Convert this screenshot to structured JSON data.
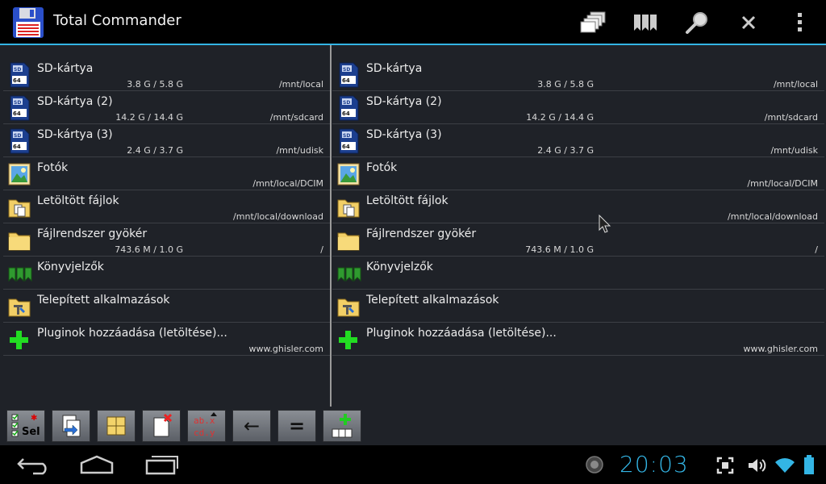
{
  "app": {
    "title": "Total Commander"
  },
  "actionbar": {
    "icons": [
      "windows-icon",
      "bookmarks-icon",
      "search-icon",
      "close-icon",
      "overflow-menu-icon"
    ]
  },
  "left_panel": {
    "rows": [
      {
        "name": "SD-kártya",
        "size": "3.8 G / 5.8 G",
        "path": "/mnt/local",
        "icon": "sd-card-icon"
      },
      {
        "name": "SD-kártya (2)",
        "size": "14.2 G / 14.4 G",
        "path": "/mnt/sdcard",
        "icon": "sd-card-icon"
      },
      {
        "name": "SD-kártya (3)",
        "size": "2.4 G / 3.7 G",
        "path": "/mnt/udisk",
        "icon": "sd-card-icon"
      },
      {
        "name": "Fotók",
        "size": "",
        "path": "/mnt/local/DCIM",
        "icon": "photos-icon"
      },
      {
        "name": "Letöltött fájlok",
        "size": "",
        "path": "/mnt/local/download",
        "icon": "downloads-folder-icon"
      },
      {
        "name": "Fájlrendszer gyökér",
        "size": "743.6 M / 1.0 G",
        "path": "/",
        "icon": "folder-icon"
      },
      {
        "name": "Könyvjelzők",
        "size": "",
        "path": "",
        "icon": "bookmarks-icon"
      },
      {
        "name": "Telepített alkalmazások",
        "size": "",
        "path": "",
        "icon": "apps-folder-icon"
      },
      {
        "name": "Pluginok hozzáadása (letöltése)...",
        "size": "",
        "path": "www.ghisler.com",
        "icon": "add-plugin-icon"
      }
    ]
  },
  "right_panel": {
    "rows": [
      {
        "name": "SD-kártya",
        "size": "3.8 G / 5.8 G",
        "path": "/mnt/local",
        "icon": "sd-card-icon"
      },
      {
        "name": "SD-kártya (2)",
        "size": "14.2 G / 14.4 G",
        "path": "/mnt/sdcard",
        "icon": "sd-card-icon"
      },
      {
        "name": "SD-kártya (3)",
        "size": "2.4 G / 3.7 G",
        "path": "/mnt/udisk",
        "icon": "sd-card-icon"
      },
      {
        "name": "Fotók",
        "size": "",
        "path": "/mnt/local/DCIM",
        "icon": "photos-icon"
      },
      {
        "name": "Letöltött fájlok",
        "size": "",
        "path": "/mnt/local/download",
        "icon": "downloads-folder-icon"
      },
      {
        "name": "Fájlrendszer gyökér",
        "size": "743.6 M / 1.0 G",
        "path": "/",
        "icon": "folder-icon"
      },
      {
        "name": "Könyvjelzők",
        "size": "",
        "path": "",
        "icon": "bookmarks-icon"
      },
      {
        "name": "Telepített alkalmazások",
        "size": "",
        "path": "",
        "icon": "apps-folder-icon"
      },
      {
        "name": "Pluginok hozzáadása (letöltése)...",
        "size": "",
        "path": "www.ghisler.com",
        "icon": "add-plugin-icon"
      }
    ]
  },
  "toolbar": {
    "sel_label": "Sel",
    "sort_label_top": "ab.x",
    "sort_label_bottom": "cd.y",
    "back_label": "←",
    "equal_label": "="
  },
  "navbar": {
    "clock": "20:03"
  },
  "colors": {
    "accent": "#33b5e5",
    "background": "#1f2228",
    "bar": "#000000"
  }
}
